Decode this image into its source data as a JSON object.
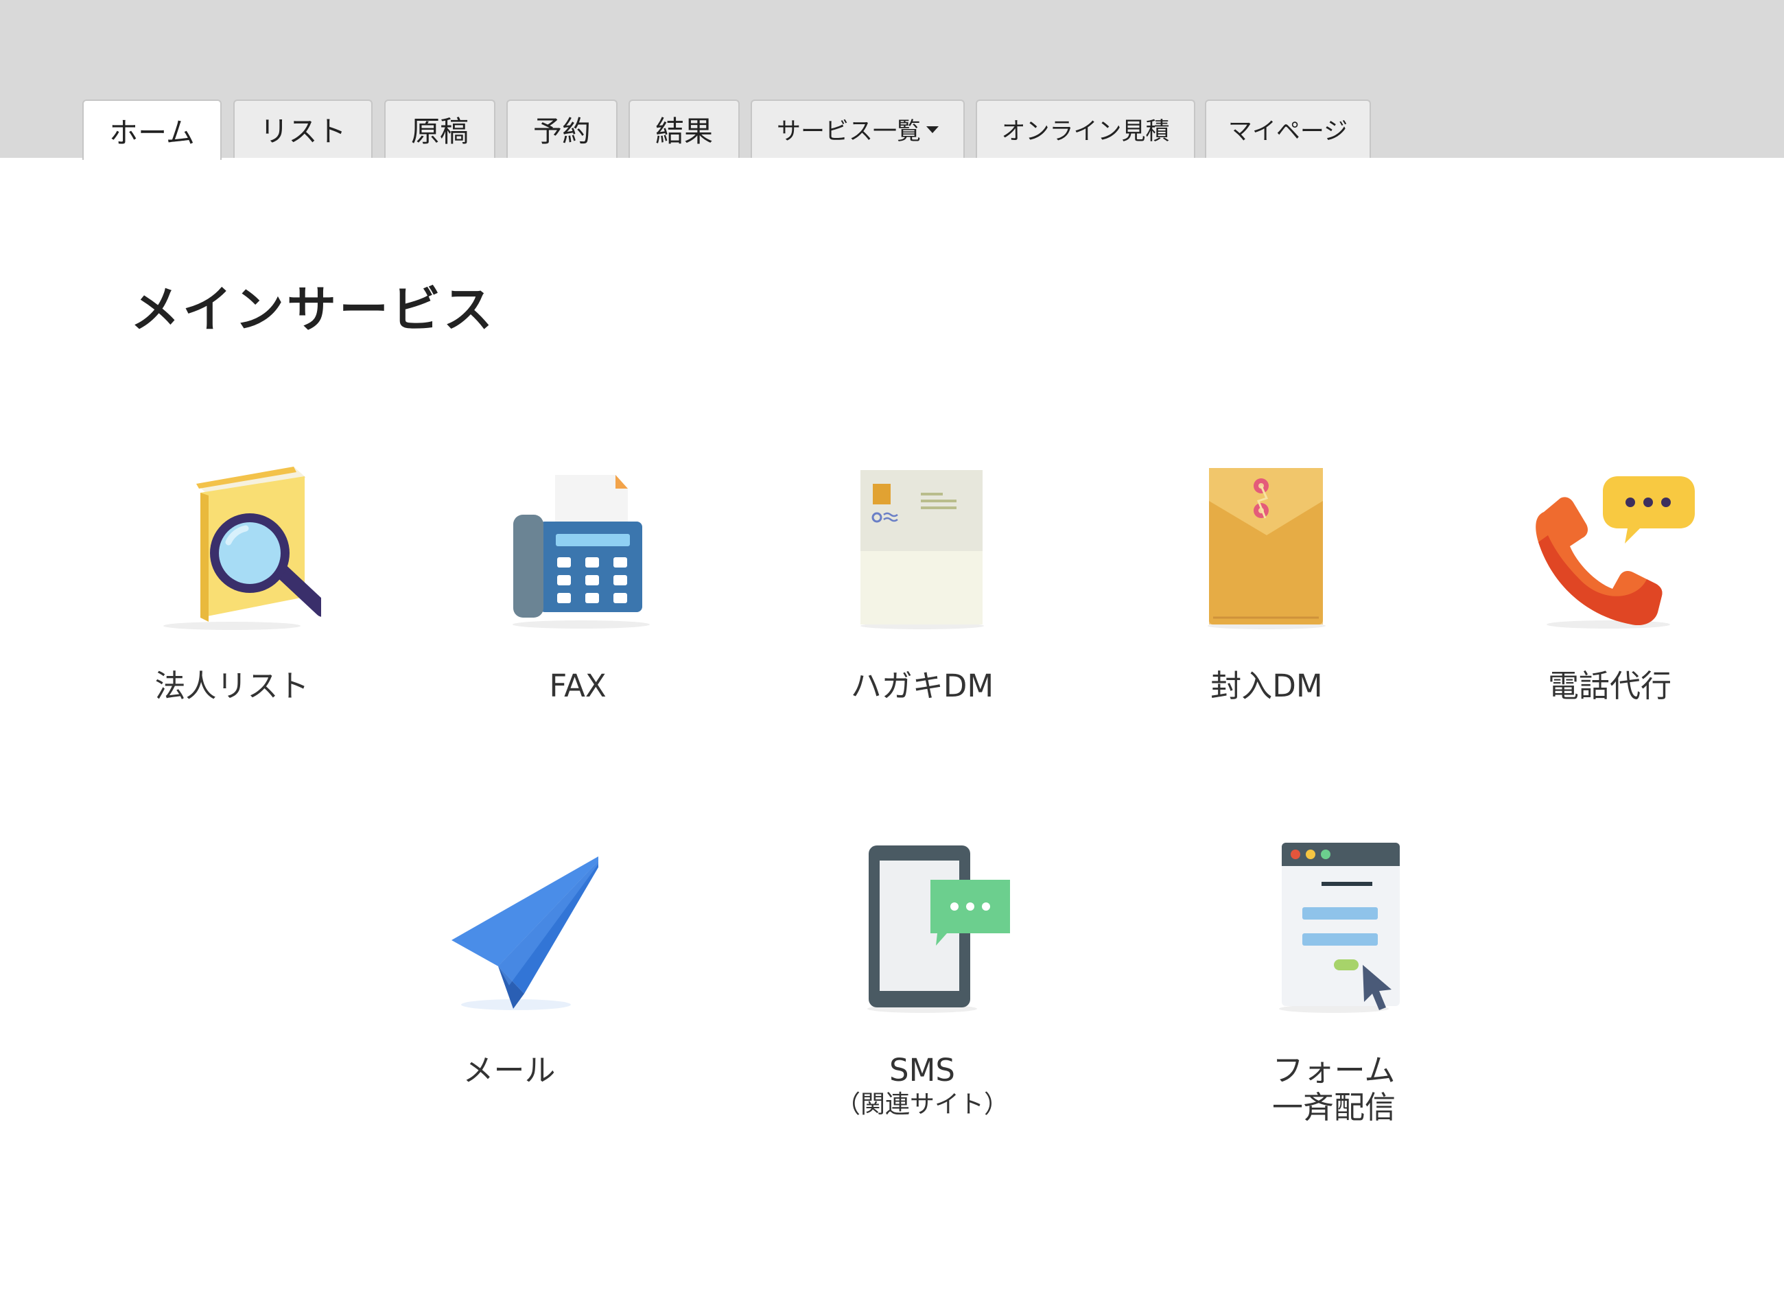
{
  "tabs": [
    {
      "label": "ホーム",
      "active": true
    },
    {
      "label": "リスト"
    },
    {
      "label": "原稿"
    },
    {
      "label": "予約"
    },
    {
      "label": "結果"
    },
    {
      "label": "サービス一覧",
      "dropdown": true
    },
    {
      "label": "オンライン見積"
    },
    {
      "label": "マイページ"
    }
  ],
  "main": {
    "title": "メインサービス",
    "services": [
      {
        "label": "法人リスト",
        "icon": "book-magnifier-icon"
      },
      {
        "label": "FAX",
        "icon": "fax-machine-icon"
      },
      {
        "label": "ハガキDM",
        "icon": "postcard-icon"
      },
      {
        "label": "封入DM",
        "icon": "envelope-icon"
      },
      {
        "label": "電話代行",
        "icon": "phone-chat-icon"
      },
      {
        "label": "メール",
        "icon": "paper-plane-icon"
      },
      {
        "label": "SMS",
        "sub": "（関連サイト）",
        "icon": "smartphone-sms-icon"
      },
      {
        "label_line1": "フォーム",
        "label_line2": "一斉配信",
        "icon": "web-form-icon"
      }
    ]
  },
  "colors": {
    "topbar": "#d9d9d9",
    "tab_bg": "#ececec",
    "tab_active_bg": "#ffffff",
    "plane_blue": "#3f86e6",
    "chat_green": "#6ccf8e",
    "envelope_gold": "#e9b24f",
    "phone_red": "#e4552b"
  }
}
